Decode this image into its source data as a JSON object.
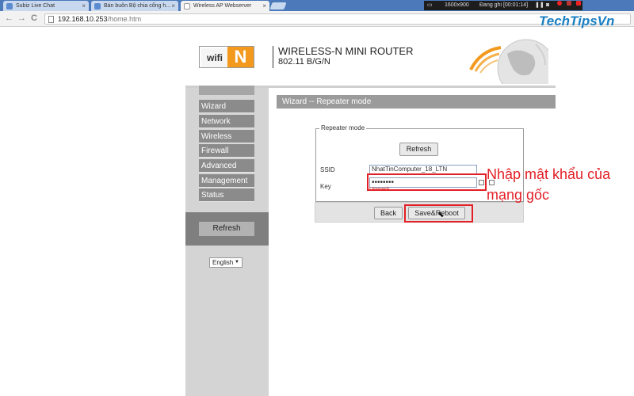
{
  "browser": {
    "tabs": [
      {
        "label": "Subiz Live Chat",
        "close": "×"
      },
      {
        "label": "Bán buôn Bộ chia cổng h...",
        "close": "×"
      },
      {
        "label": "Wireless AP Webserver",
        "close": "×"
      }
    ],
    "url_host": "192.168.10.253",
    "url_path": "/home.htm",
    "nav_back": "←",
    "nav_forward": "→",
    "nav_reload": "C"
  },
  "recorder": {
    "resolution": "1600x900",
    "status": "Đang ghi [00:01:14]"
  },
  "brand": "TechTipsVn",
  "router": {
    "logo_left": "wifi",
    "logo_right": "N",
    "title": "WIRELESS-N MINI ROUTER",
    "subtitle": "802.11 B/G/N"
  },
  "menu": [
    {
      "label": "Wizard"
    },
    {
      "label": "Network"
    },
    {
      "label": "Wireless"
    },
    {
      "label": "Firewall"
    },
    {
      "label": "Advanced"
    },
    {
      "label": "Management"
    },
    {
      "label": "Status"
    }
  ],
  "sidebar_refresh": "Refresh",
  "language": {
    "selected": "English",
    "arrow": "▼"
  },
  "section_title": "Wizard -- Repeater mode",
  "repeater": {
    "legend": "Repeater mode",
    "refresh_label": "Refresh",
    "ssid_label": "SSID",
    "ssid_value": "NhatTinComputer_18_LTN",
    "key_label": "Key",
    "key_value": "••••••••",
    "unmask_label": "Unmask",
    "back_label": "Back",
    "save_label": "Save&Reboot"
  },
  "annotation": "Nhập mật khẩu của mạng gốc",
  "colors": {
    "accent_orange": "#f39a1e",
    "highlight_red": "#e31f26",
    "brand_blue": "#1a7fc2"
  }
}
